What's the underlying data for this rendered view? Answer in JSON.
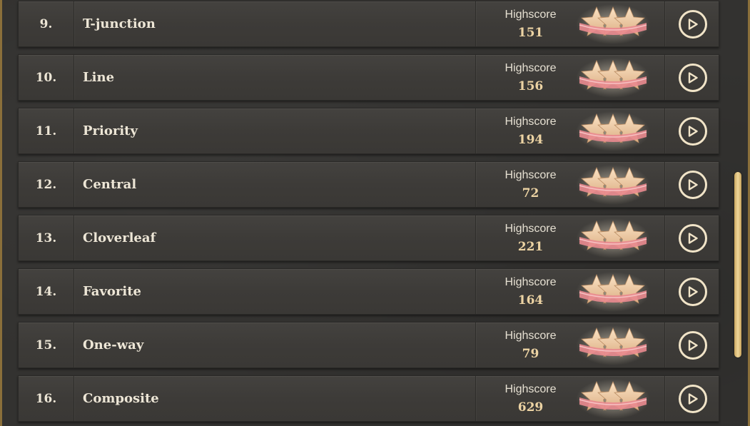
{
  "score_label": "Highscore",
  "levels": [
    {
      "number": "9.",
      "name": "T-junction",
      "score": "151",
      "stars": 3
    },
    {
      "number": "10.",
      "name": "Line",
      "score": "156",
      "stars": 3
    },
    {
      "number": "11.",
      "name": "Priority",
      "score": "194",
      "stars": 3
    },
    {
      "number": "12.",
      "name": "Central",
      "score": "72",
      "stars": 3
    },
    {
      "number": "13.",
      "name": "Cloverleaf",
      "score": "221",
      "stars": 3
    },
    {
      "number": "14.",
      "name": "Favorite",
      "score": "164",
      "stars": 3
    },
    {
      "number": "15.",
      "name": "One-way",
      "score": "79",
      "stars": 3
    },
    {
      "number": "16.",
      "name": "Composite",
      "score": "629",
      "stars": 3
    }
  ],
  "icons": {
    "play": "play-icon",
    "star": "star-icon"
  },
  "colors": {
    "accent": "#f1e4c8",
    "score": "#ecd3a3",
    "star": "#f1c9a0",
    "ribbon": "#e98a8f"
  }
}
